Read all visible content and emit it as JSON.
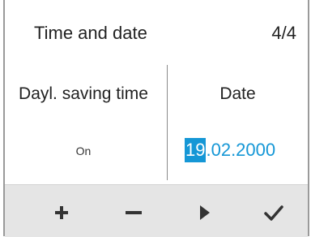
{
  "header": {
    "title": "Time and date",
    "page_counter": "4/4"
  },
  "columns": {
    "left": {
      "heading": "Dayl. saving time",
      "value": "On"
    },
    "right": {
      "heading": "Date",
      "day": "19",
      "rest": ".02.2000"
    }
  },
  "toolbar": {
    "buttons": [
      {
        "icon": "plus-icon"
      },
      {
        "icon": "minus-icon"
      },
      {
        "icon": "play-icon"
      },
      {
        "icon": "checkmark-icon"
      }
    ]
  },
  "colors": {
    "accent": "#1597d6",
    "toolbar_bg": "#e5e5e5",
    "icon": "#333333"
  }
}
